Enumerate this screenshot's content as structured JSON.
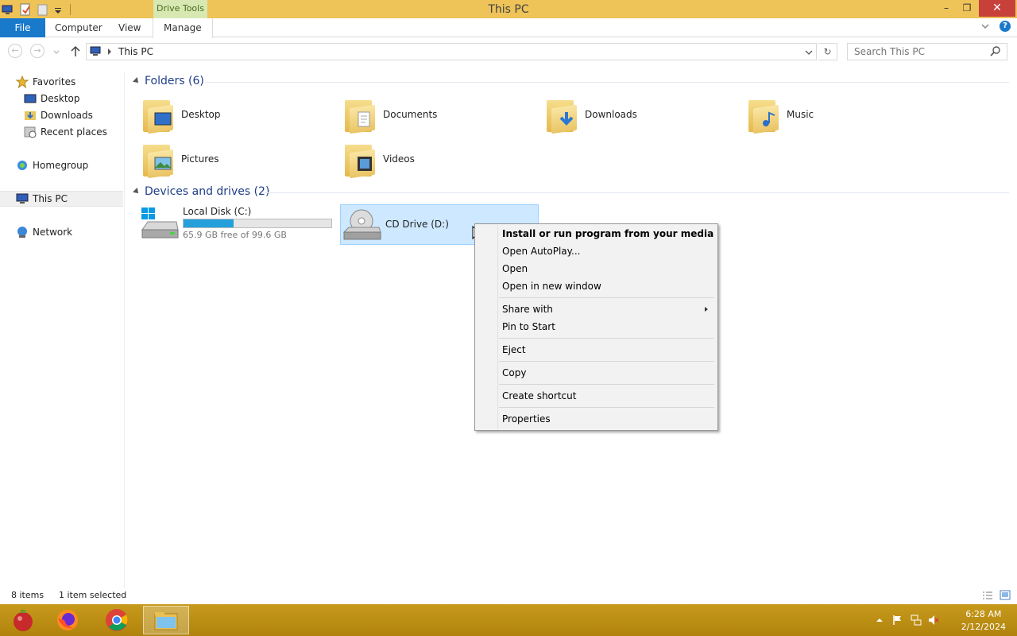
{
  "window": {
    "title": "This PC",
    "context_tab": "Drive Tools",
    "minimize": "–",
    "restore": "❐",
    "close": "✕"
  },
  "ribbon": {
    "tabs": [
      "File",
      "Computer",
      "View",
      "Manage"
    ]
  },
  "address": {
    "path": "This PC",
    "search_placeholder": "Search This PC"
  },
  "nav": {
    "favorites": "Favorites",
    "favorites_items": [
      "Desktop",
      "Downloads",
      "Recent places"
    ],
    "homegroup": "Homegroup",
    "this_pc": "This PC",
    "network": "Network"
  },
  "folders": {
    "header": "Folders (6)",
    "items": [
      "Desktop",
      "Documents",
      "Downloads",
      "Music",
      "Pictures",
      "Videos"
    ]
  },
  "devices": {
    "header": "Devices and drives (2)",
    "local_disk": {
      "name": "Local Disk (C:)",
      "free_text": "65.9 GB free of 99.6 GB",
      "used_fraction": 0.338
    },
    "cd_drive": {
      "name": "CD Drive (D:)"
    }
  },
  "context_menu": {
    "items": [
      "Install or run program from your media",
      "Open AutoPlay...",
      "Open",
      "Open in new window",
      "Share with",
      "Pin to Start",
      "Eject",
      "Copy",
      "Create shortcut",
      "Properties"
    ]
  },
  "status": {
    "items_count": "8 items",
    "selected": "1 item selected"
  },
  "taskbar": {
    "time": "6:28 AM",
    "date": "2/12/2024"
  },
  "colors": {
    "titlebar": "#eec358",
    "file_tab": "#1979ca",
    "taskbar": "#b8880e",
    "selection": "#cde8ff",
    "progress": "#26a0da"
  }
}
